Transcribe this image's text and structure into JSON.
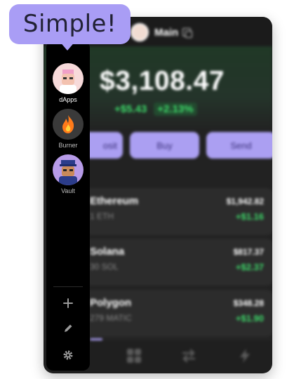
{
  "callout": {
    "text": "Simple!"
  },
  "header": {
    "account_name": "Main",
    "avatar_icon": "account-avatar",
    "copy_icon": "copy-icon"
  },
  "portfolio": {
    "balance": "$3,108.47",
    "change_amount": "+$5.43",
    "change_percent": "+2.13%"
  },
  "actions": {
    "deposit_label": "osit",
    "buy_label": "Buy",
    "send_label": "Send"
  },
  "tokens": [
    {
      "name": "Ethereum",
      "amount": "1 ETH",
      "value": "$1,942.82",
      "change": "+$1.16"
    },
    {
      "name": "Solana",
      "amount": "30 SOL",
      "value": "$817.37",
      "change": "+$2.37"
    },
    {
      "name": "Polygon",
      "amount": "279 MATIC",
      "value": "$348.28",
      "change": "+$1.90"
    }
  ],
  "sidebar": {
    "items": [
      {
        "label": "dApps",
        "icon": "dapps-avatar"
      },
      {
        "label": "Burner",
        "icon": "fire-icon"
      },
      {
        "label": "Vault",
        "icon": "vault-avatar"
      }
    ],
    "add_icon": "plus-icon",
    "edit_icon": "pencil-icon",
    "settings_icon": "gear-icon"
  },
  "bottom_nav": {
    "tabs": [
      "wallet-icon",
      "grid-icon",
      "swap-icon",
      "lightning-icon"
    ]
  },
  "colors": {
    "accent": "#ab9ff2",
    "positive": "#3ddc6a",
    "background": "#222222",
    "sidebar": "#000000"
  }
}
